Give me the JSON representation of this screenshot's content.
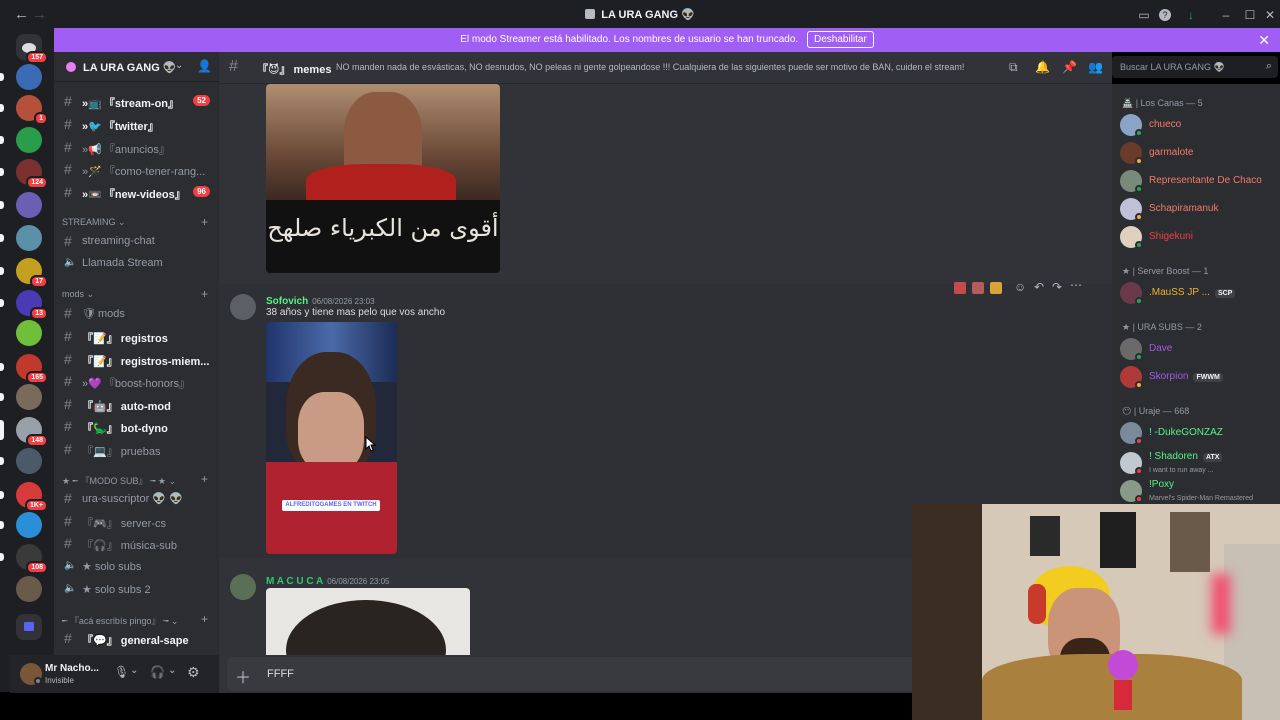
{
  "window": {
    "title": "LA URA GANG 👽"
  },
  "banner": {
    "text": "El modo Streamer está habilitado. Los nombres de usuario se han truncado.",
    "button": "Deshabilitar"
  },
  "servers": {
    "home_badge": "157",
    "items": [
      {
        "badge": ""
      },
      {
        "badge": "1"
      },
      {
        "badge": ""
      },
      {
        "badge": "124"
      },
      {
        "badge": ""
      },
      {
        "badge": ""
      },
      {
        "badge": "17"
      },
      {
        "badge": "13"
      },
      {
        "badge": ""
      },
      {
        "badge": "165"
      },
      {
        "badge": ""
      },
      {
        "badge": "148"
      },
      {
        "badge": ""
      },
      {
        "badge": "1K+"
      },
      {
        "badge": ""
      },
      {
        "badge": "108"
      },
      {
        "badge": ""
      }
    ]
  },
  "server": {
    "name": "LA URA GANG 👽"
  },
  "channels": [
    {
      "name": "『stream-on』",
      "prefix": "»📺",
      "badge": "52",
      "unread": true
    },
    {
      "name": "『twitter』",
      "prefix": "»🐦",
      "badge": "",
      "unread": true
    },
    {
      "name": "『anuncios』",
      "prefix": "»📢",
      "badge": "",
      "unread": false
    },
    {
      "name": "『como-tener-rang...",
      "prefix": "»🪄",
      "badge": "",
      "unread": false
    },
    {
      "name": "『new-videos』",
      "prefix": "»📼",
      "badge": "96",
      "unread": true
    }
  ],
  "categories": {
    "streaming": "STREAMING",
    "mods": "mods",
    "modo_sub": "★ ╾ 『MODO SUB』 ╼ ★",
    "aca": "╾ 『acá escribís pingo』 ╼"
  },
  "streaming_channels": [
    {
      "name": "streaming-chat",
      "type": "text"
    },
    {
      "name": "Llamada Stream",
      "type": "voice"
    }
  ],
  "mods_channels": [
    {
      "name": "mods",
      "prefix": "🛡",
      "unread": false,
      "type": "forum"
    },
    {
      "name": "『📝』 registros",
      "unread": true,
      "type": "text"
    },
    {
      "name": "『📝』 registros-miem...",
      "unread": true,
      "type": "text"
    },
    {
      "name": "『boost-honors』",
      "prefix": "»💜",
      "unread": false,
      "type": "text"
    },
    {
      "name": "『🤖』 auto-mod",
      "unread": true,
      "type": "text"
    },
    {
      "name": "『🦕』 bot-dyno",
      "unread": true,
      "type": "text"
    },
    {
      "name": "『💻』 pruebas",
      "unread": false,
      "type": "text"
    }
  ],
  "sub_channels": [
    {
      "name": "ura-suscriptor 👽 👽",
      "type": "text"
    },
    {
      "name": "『🎮』 server-cs",
      "type": "text"
    },
    {
      "name": "『🎧』 música-sub",
      "type": "text"
    },
    {
      "name": "★ solo subs",
      "type": "voice"
    },
    {
      "name": "★ solo subs 2",
      "type": "voice"
    }
  ],
  "aca_channels": [
    {
      "name": "『💬』 general-sape",
      "type": "text"
    }
  ],
  "user": {
    "name": "Mr Nacho...",
    "status": "Invisible"
  },
  "chat_header": {
    "channel": "『😈』 memes",
    "topic": "NO manden nada de esvásticas, NO desnudos, NO peleas ni gente golpeandose !!! Cualquiera de las siguientes puede ser motivo de BAN, cuiden el stream!"
  },
  "search": {
    "placeholder": "Buscar LA URA GANG 👽"
  },
  "messages": [
    {
      "image_caption": "أقوى من الكبرياء صلهح"
    },
    {
      "author": "Sofovich",
      "time": "06/08/2026 23:03",
      "text": "38 años y tiene mas pelo que vos ancho",
      "image_caption": "ALFREDITOGAMES EN TWITCH"
    },
    {
      "author": "M A C U C A",
      "time": "06/08/2026 23:05"
    }
  ],
  "composer": {
    "value": "FFFF"
  },
  "members": {
    "groups": [
      {
        "label": "🏯 | Los Canas — 5",
        "members": [
          {
            "name": "chueco",
            "color": "#f47b67"
          },
          {
            "name": "garmalote",
            "color": "#f47b67"
          },
          {
            "name": "Representante De Chaco",
            "color": "#f47b67"
          },
          {
            "name": "Schapiramanuk",
            "color": "#f47b67"
          },
          {
            "name": "Shigekuni",
            "color": "#f23f43"
          }
        ]
      },
      {
        "label": "★ | Server Boost — 1",
        "members": [
          {
            "name": ".MauSS JP ...",
            "tag": "SCP",
            "color": "#f0b232"
          }
        ]
      },
      {
        "label": "★ | URA SUBS — 2",
        "members": [
          {
            "name": "Dave",
            "color": "#a25ce5"
          },
          {
            "name": "Skorpion",
            "tag": "FWWM",
            "color": "#a25ce5"
          }
        ]
      },
      {
        "label": "😶 | Uraje — 668",
        "members": [
          {
            "name": "! -DukeGONZAZ",
            "color": "#57f287",
            "sub": ""
          },
          {
            "name": "! Shadoren",
            "tag": "ATX",
            "color": "#57f287",
            "sub": "I want to run away ..."
          },
          {
            "name": "!Poxy",
            "color": "#57f287",
            "sub": "Marvel's Spider-Man Remastered"
          }
        ]
      }
    ]
  }
}
